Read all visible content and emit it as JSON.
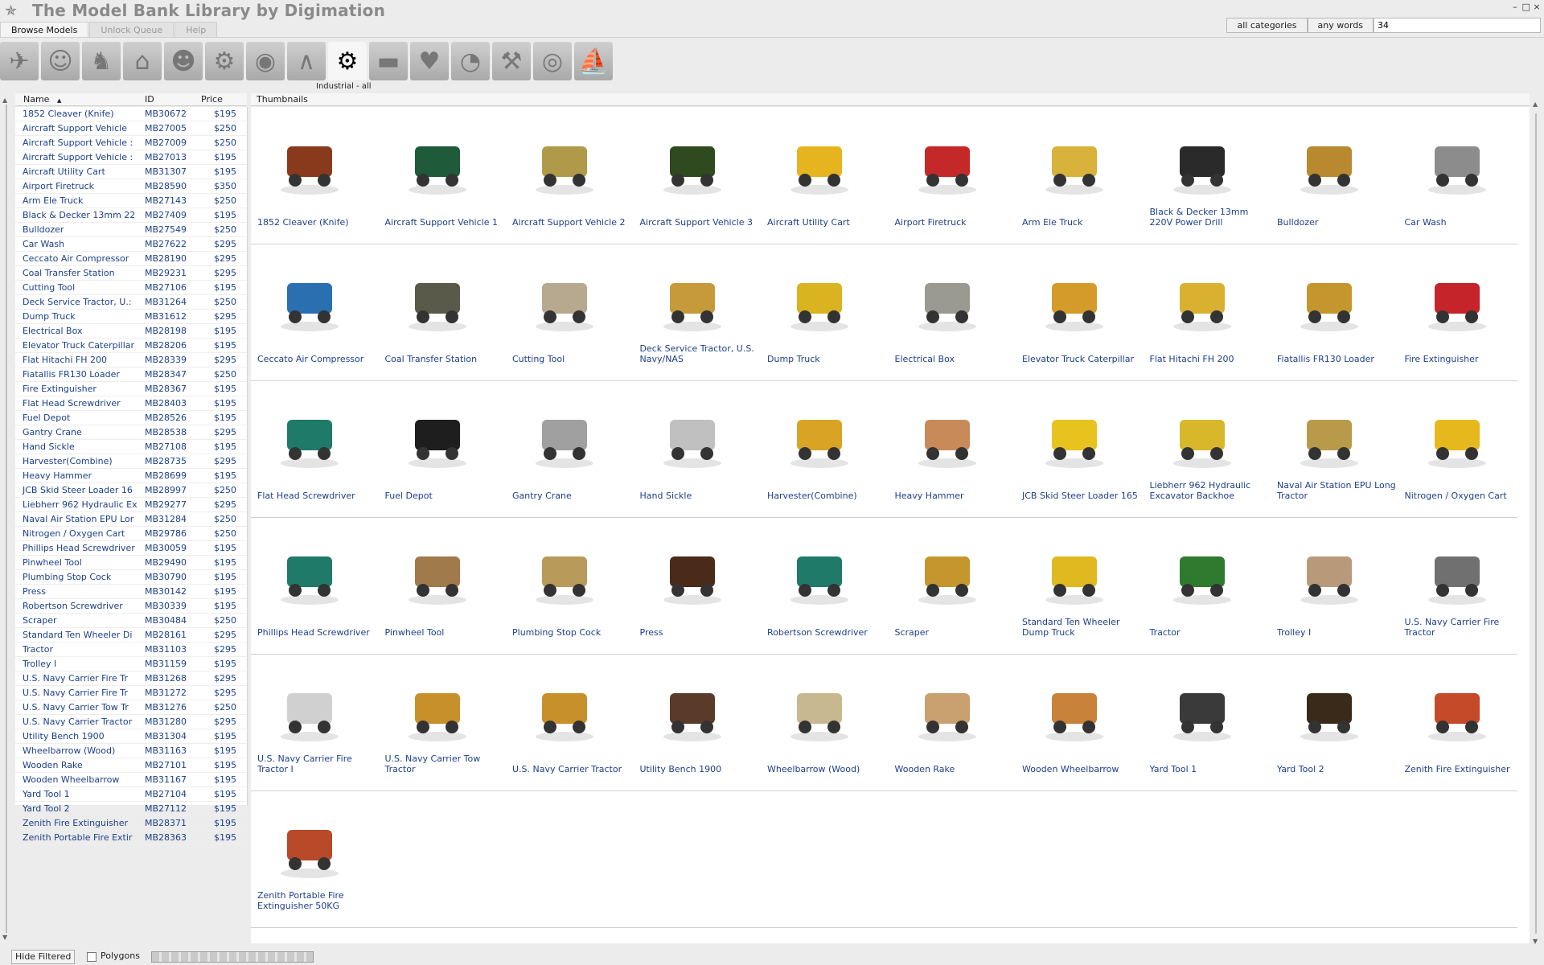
{
  "app": {
    "title": "The Model Bank Library by Digimation",
    "window_controls": [
      "–",
      "□",
      "×"
    ]
  },
  "search": {
    "category_button": "all categories",
    "mode_button": "any words",
    "query": "34"
  },
  "tabs": [
    {
      "label": "Browse Models",
      "active": true
    },
    {
      "label": "Unlock Queue",
      "active": false
    },
    {
      "label": "Help",
      "active": false
    }
  ],
  "categories": {
    "selected_label": "Industrial - all",
    "items": [
      {
        "icon": "airplane-icon",
        "glyph": "✈",
        "active": false
      },
      {
        "icon": "head-icon",
        "glyph": "☺",
        "active": false
      },
      {
        "icon": "horse-icon",
        "glyph": "♞",
        "active": false
      },
      {
        "icon": "building-icon",
        "glyph": "⌂",
        "active": false
      },
      {
        "icon": "runner-icon",
        "glyph": "☻",
        "active": false
      },
      {
        "icon": "tractor-icon",
        "glyph": "⚙",
        "active": false
      },
      {
        "icon": "car-icon",
        "glyph": "◉",
        "active": false
      },
      {
        "icon": "hanger-icon",
        "glyph": "∧",
        "active": false
      },
      {
        "icon": "gear-icon",
        "glyph": "⚙",
        "active": true
      },
      {
        "icon": "tank-icon",
        "glyph": "▬",
        "active": false
      },
      {
        "icon": "fruit-icon",
        "glyph": "♥",
        "active": false
      },
      {
        "icon": "eye-icon",
        "glyph": "◔",
        "active": false
      },
      {
        "icon": "tools-icon",
        "glyph": "⚒",
        "active": false
      },
      {
        "icon": "ball-icon",
        "glyph": "◎",
        "active": false
      },
      {
        "icon": "sailboat-icon",
        "glyph": "⛵",
        "active": false
      }
    ]
  },
  "list": {
    "headers": {
      "name": "Name",
      "id": "ID",
      "price": "Price",
      "sort_indicator": "▲"
    },
    "rows": [
      {
        "name": "1852 Cleaver (Knife)",
        "id": "MB30672",
        "price": "$195"
      },
      {
        "name": "Aircraft Support Vehicle",
        "id": "MB27005",
        "price": "$250"
      },
      {
        "name": "Aircraft Support Vehicle :",
        "id": "MB27009",
        "price": "$250"
      },
      {
        "name": "Aircraft Support Vehicle :",
        "id": "MB27013",
        "price": "$195"
      },
      {
        "name": "Aircraft Utility Cart",
        "id": "MB31307",
        "price": "$195"
      },
      {
        "name": "Airport Firetruck",
        "id": "MB28590",
        "price": "$350"
      },
      {
        "name": "Arm Ele Truck",
        "id": "MB27143",
        "price": "$250"
      },
      {
        "name": "Black & Decker 13mm 22",
        "id": "MB27409",
        "price": "$195"
      },
      {
        "name": "Bulldozer",
        "id": "MB27549",
        "price": "$250"
      },
      {
        "name": "Car Wash",
        "id": "MB27622",
        "price": "$295"
      },
      {
        "name": "Ceccato Air Compressor",
        "id": "MB28190",
        "price": "$295"
      },
      {
        "name": "Coal Transfer Station",
        "id": "MB29231",
        "price": "$295"
      },
      {
        "name": "Cutting Tool",
        "id": "MB27106",
        "price": "$195"
      },
      {
        "name": "Deck Service Tractor, U.:",
        "id": "MB31264",
        "price": "$250"
      },
      {
        "name": "Dump Truck",
        "id": "MB31612",
        "price": "$295"
      },
      {
        "name": "Electrical Box",
        "id": "MB28198",
        "price": "$195"
      },
      {
        "name": "Elevator Truck Caterpillar",
        "id": "MB28206",
        "price": "$195"
      },
      {
        "name": "Flat Hitachi FH 200",
        "id": "MB28339",
        "price": "$295"
      },
      {
        "name": "Fiatallis FR130 Loader",
        "id": "MB28347",
        "price": "$250"
      },
      {
        "name": "Fire Extinguisher",
        "id": "MB28367",
        "price": "$195"
      },
      {
        "name": "Flat Head Screwdriver",
        "id": "MB28403",
        "price": "$195"
      },
      {
        "name": "Fuel Depot",
        "id": "MB28526",
        "price": "$195"
      },
      {
        "name": "Gantry Crane",
        "id": "MB28538",
        "price": "$295"
      },
      {
        "name": "Hand Sickle",
        "id": "MB27108",
        "price": "$195"
      },
      {
        "name": "Harvester(Combine)",
        "id": "MB28735",
        "price": "$295"
      },
      {
        "name": "Heavy Hammer",
        "id": "MB28699",
        "price": "$195"
      },
      {
        "name": "JCB Skid Steer Loader 16",
        "id": "MB28997",
        "price": "$250"
      },
      {
        "name": "Liebherr 962 Hydraulic Ex",
        "id": "MB29277",
        "price": "$295"
      },
      {
        "name": "Naval Air Station EPU Lor",
        "id": "MB31284",
        "price": "$250"
      },
      {
        "name": "Nitrogen / Oxygen Cart",
        "id": "MB29786",
        "price": "$250"
      },
      {
        "name": "Phillips Head Screwdriver",
        "id": "MB30059",
        "price": "$195"
      },
      {
        "name": "Pinwheel Tool",
        "id": "MB29490",
        "price": "$195"
      },
      {
        "name": "Plumbing Stop Cock",
        "id": "MB30790",
        "price": "$195"
      },
      {
        "name": "Press",
        "id": "MB30142",
        "price": "$195"
      },
      {
        "name": "Robertson Screwdriver",
        "id": "MB30339",
        "price": "$195"
      },
      {
        "name": "Scraper",
        "id": "MB30484",
        "price": "$250"
      },
      {
        "name": "Standard Ten Wheeler Di",
        "id": "MB28161",
        "price": "$295"
      },
      {
        "name": "Tractor",
        "id": "MB31103",
        "price": "$295"
      },
      {
        "name": "Trolley I",
        "id": "MB31159",
        "price": "$195"
      },
      {
        "name": "U.S. Navy Carrier Fire Tr",
        "id": "MB31268",
        "price": "$295"
      },
      {
        "name": "U.S. Navy Carrier Fire Tr",
        "id": "MB31272",
        "price": "$295"
      },
      {
        "name": "U.S. Navy Carrier Tow Tr",
        "id": "MB31276",
        "price": "$250"
      },
      {
        "name": "U.S. Navy Carrier Tractor",
        "id": "MB31280",
        "price": "$295"
      },
      {
        "name": "Utility Bench 1900",
        "id": "MB31304",
        "price": "$195"
      },
      {
        "name": "Wheelbarrow (Wood)",
        "id": "MB31163",
        "price": "$195"
      },
      {
        "name": "Wooden Rake",
        "id": "MB27101",
        "price": "$195"
      },
      {
        "name": "Wooden Wheelbarrow",
        "id": "MB31167",
        "price": "$195"
      },
      {
        "name": "Yard Tool 1",
        "id": "MB27104",
        "price": "$195"
      },
      {
        "name": "Yard Tool 2",
        "id": "MB27112",
        "price": "$195"
      },
      {
        "name": "Zenith Fire Extinguisher",
        "id": "MB28371",
        "price": "$195"
      },
      {
        "name": "Zenith Portable Fire Extir",
        "id": "MB28363",
        "price": "$195"
      }
    ]
  },
  "thumbnails": {
    "header": "Thumbnails",
    "items": [
      {
        "caption": "1852 Cleaver (Knife)",
        "icon": "cleaver-icon",
        "color": "#8a3a1c"
      },
      {
        "caption": "Aircraft Support Vehicle 1",
        "icon": "tractor-icon",
        "color": "#1f5a3a"
      },
      {
        "caption": "Aircraft Support Vehicle 2",
        "icon": "cart-icon",
        "color": "#b09a4a"
      },
      {
        "caption": "Aircraft Support Vehicle 3",
        "icon": "cart-icon",
        "color": "#2e4a1e"
      },
      {
        "caption": "Aircraft Utility Cart",
        "icon": "cart-icon",
        "color": "#e6b41e"
      },
      {
        "caption": "Airport Firetruck",
        "icon": "firetruck-icon",
        "color": "#c42828"
      },
      {
        "caption": "Arm Ele Truck",
        "icon": "crane-icon",
        "color": "#d8b23a"
      },
      {
        "caption": "Black & Decker 13mm 220V Power Drill",
        "icon": "drill-icon",
        "color": "#2a2a2a"
      },
      {
        "caption": "Bulldozer",
        "icon": "bulldozer-icon",
        "color": "#b8892e"
      },
      {
        "caption": "Car Wash",
        "icon": "carwash-icon",
        "color": "#8c8c8c"
      },
      {
        "caption": "Ceccato Air Compressor",
        "icon": "compressor-icon",
        "color": "#2a6fb0"
      },
      {
        "caption": "Coal Transfer Station",
        "icon": "station-icon",
        "color": "#5a5a4a"
      },
      {
        "caption": "Cutting Tool",
        "icon": "blade-icon",
        "color": "#b7a890"
      },
      {
        "caption": "Deck Service Tractor, U.S. Navy/NAS",
        "icon": "tractor-icon",
        "color": "#c69a3a"
      },
      {
        "caption": "Dump Truck",
        "icon": "dumptruck-icon",
        "color": "#d9b320"
      },
      {
        "caption": "Electrical Box",
        "icon": "box-icon",
        "color": "#9a9a90"
      },
      {
        "caption": "Elevator Truck Caterpillar",
        "icon": "forklift-icon",
        "color": "#d49a2a"
      },
      {
        "caption": "Flat Hitachi FH 200",
        "icon": "excavator-icon",
        "color": "#d9b030"
      },
      {
        "caption": "Fiatallis FR130 Loader",
        "icon": "loader-icon",
        "color": "#c6962e"
      },
      {
        "caption": "Fire Extinguisher",
        "icon": "extinguisher-icon",
        "color": "#c4242a"
      },
      {
        "caption": "Flat Head Screwdriver",
        "icon": "screwdriver-icon",
        "color": "#1f7a6a"
      },
      {
        "caption": "Fuel Depot",
        "icon": "tank-icon",
        "color": "#1e1e1e"
      },
      {
        "caption": "Gantry Crane",
        "icon": "gantry-icon",
        "color": "#a0a0a0"
      },
      {
        "caption": "Hand Sickle",
        "icon": "sickle-icon",
        "color": "#c0c0c0"
      },
      {
        "caption": "Harvester(Combine)",
        "icon": "harvester-icon",
        "color": "#d9a426"
      },
      {
        "caption": "Heavy Hammer",
        "icon": "hammer-icon",
        "color": "#c98a5a"
      },
      {
        "caption": "JCB Skid Steer Loader 165",
        "icon": "loader-icon",
        "color": "#e8c21e"
      },
      {
        "caption": "Liebherr 962 Hydraulic Excavator Backhoe",
        "icon": "excavator-icon",
        "color": "#d8b82a"
      },
      {
        "caption": "Naval Air Station EPU Long Tractor",
        "icon": "tractor-icon",
        "color": "#b89a4a"
      },
      {
        "caption": "Nitrogen / Oxygen Cart",
        "icon": "cart-icon",
        "color": "#e6b81e"
      },
      {
        "caption": "Phillips Head Screwdriver",
        "icon": "screwdriver-icon",
        "color": "#1f7a6a"
      },
      {
        "caption": "Pinwheel Tool",
        "icon": "pinwheel-icon",
        "color": "#a07a4a"
      },
      {
        "caption": "Plumbing Stop Cock",
        "icon": "valve-icon",
        "color": "#b89a5a"
      },
      {
        "caption": "Press",
        "icon": "press-icon",
        "color": "#4a2a18"
      },
      {
        "caption": "Robertson Screwdriver",
        "icon": "screwdriver-icon",
        "color": "#1f7a6a"
      },
      {
        "caption": "Scraper",
        "icon": "scraper-icon",
        "color": "#c6962e"
      },
      {
        "caption": "Standard Ten Wheeler Dump Truck",
        "icon": "dumptruck-icon",
        "color": "#e0b820"
      },
      {
        "caption": "Tractor",
        "icon": "steam-tractor-icon",
        "color": "#2e7a2e"
      },
      {
        "caption": "Trolley I",
        "icon": "trolley-icon",
        "color": "#b89a7a"
      },
      {
        "caption": "U.S. Navy Carrier Fire Tractor",
        "icon": "firetruck-icon",
        "color": "#707070"
      },
      {
        "caption": "U.S. Navy Carrier Fire Tractor I",
        "icon": "firetruck-icon",
        "color": "#d0d0d0"
      },
      {
        "caption": "U.S. Navy Carrier Tow Tractor",
        "icon": "tractor-icon",
        "color": "#c8902a"
      },
      {
        "caption": "U.S. Navy Carrier Tractor",
        "icon": "tractor-icon",
        "color": "#c8902a"
      },
      {
        "caption": "Utility Bench 1900",
        "icon": "bench-icon",
        "color": "#5a3a28"
      },
      {
        "caption": "Wheelbarrow (Wood)",
        "icon": "wheelbarrow-icon",
        "color": "#c8b890"
      },
      {
        "caption": "Wooden Rake",
        "icon": "rake-icon",
        "color": "#c9a070"
      },
      {
        "caption": "Wooden Wheelbarrow",
        "icon": "wheelbarrow-icon",
        "color": "#c8823a"
      },
      {
        "caption": "Yard Tool 1",
        "icon": "yardtool-icon",
        "color": "#3a3a3a"
      },
      {
        "caption": "Yard Tool 2",
        "icon": "yardtool-icon",
        "color": "#3a2a1a"
      },
      {
        "caption": "Zenith Fire Extinguisher",
        "icon": "extinguisher-icon",
        "color": "#c44a2a"
      },
      {
        "caption": "Zenith Portable Fire Extinguisher 50KG",
        "icon": "extinguisher-icon",
        "color": "#b84a2a"
      }
    ]
  },
  "bottom": {
    "hide_button": "Hide Filtered",
    "polygons_label": "Polygons",
    "polygons_checked": false
  }
}
